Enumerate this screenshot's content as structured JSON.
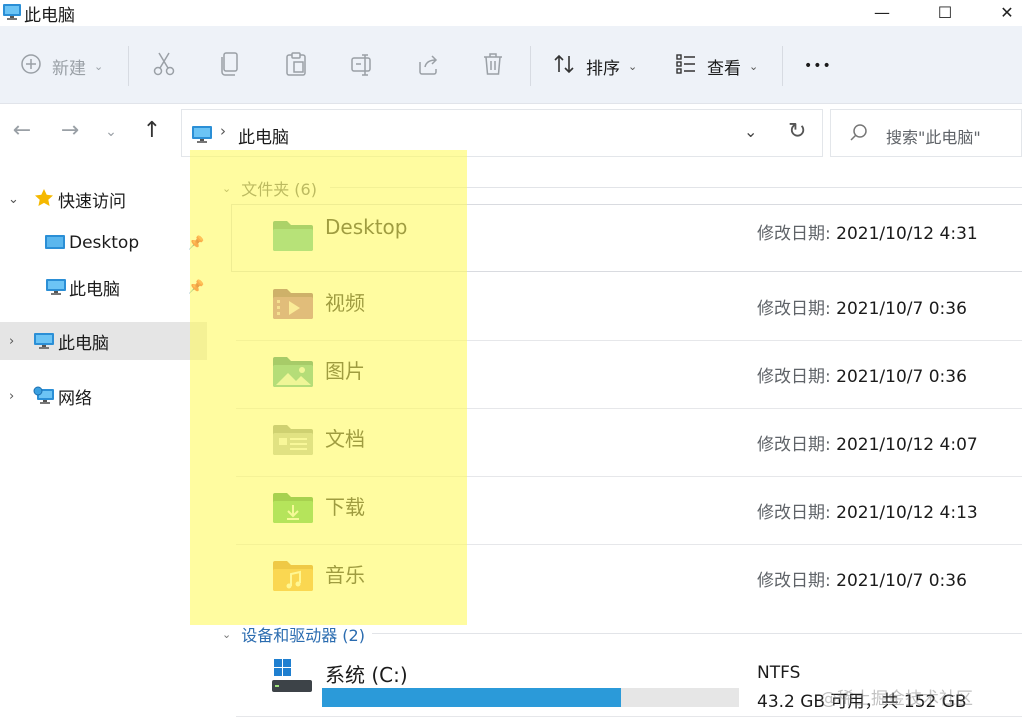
{
  "window": {
    "title": "此电脑",
    "minimize": "—",
    "maximize": "☐",
    "close": "✕"
  },
  "toolbar": {
    "new_label": "新建",
    "sort_label": "排序",
    "view_label": "查看",
    "more_label": "•••"
  },
  "address": {
    "path": "此电脑",
    "search_placeholder": "搜索\"此电脑\""
  },
  "sidebar": {
    "items": [
      {
        "label": "快速访问"
      },
      {
        "label": "Desktop"
      },
      {
        "label": "此电脑"
      },
      {
        "label": "此电脑"
      },
      {
        "label": "网络"
      }
    ]
  },
  "folders_group": {
    "label": "文件夹 (6)"
  },
  "folders": [
    {
      "name": "Desktop",
      "date_label": "修改日期:",
      "date": "2021/10/12 4:31",
      "icon": "desktop-folder-icon"
    },
    {
      "name": "视频",
      "date_label": "修改日期:",
      "date": "2021/10/7 0:36",
      "icon": "videos-folder-icon"
    },
    {
      "name": "图片",
      "date_label": "修改日期:",
      "date": "2021/10/7 0:36",
      "icon": "pictures-folder-icon"
    },
    {
      "name": "文档",
      "date_label": "修改日期:",
      "date": "2021/10/12 4:07",
      "icon": "documents-folder-icon"
    },
    {
      "name": "下载",
      "date_label": "修改日期:",
      "date": "2021/10/12 4:13",
      "icon": "downloads-folder-icon"
    },
    {
      "name": "音乐",
      "date_label": "修改日期:",
      "date": "2021/10/7 0:36",
      "icon": "music-folder-icon"
    }
  ],
  "drives_group": {
    "label": "设备和驱动器 (2)"
  },
  "drive": {
    "name": "系统 (C:)",
    "filesystem": "NTFS",
    "space": "43.2 GB 可用，共 152 GB",
    "used_fraction": 0.716
  },
  "watermark": "@稀土掘金技术社区",
  "colors": {
    "accent": "#2b9ad9",
    "highlight": "#fffa5c",
    "toolbar_bg": "#eef2f8"
  }
}
